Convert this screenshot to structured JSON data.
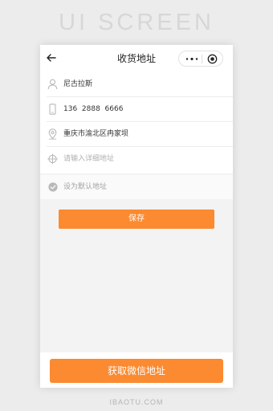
{
  "banner": {
    "text": "UI SCREEN"
  },
  "navbar": {
    "title": "收货地址",
    "back_icon": "arrow-left-icon",
    "menu_icon": "more-dots-icon",
    "close_icon": "target-circle-icon"
  },
  "form": {
    "rows": [
      {
        "icon": "person-icon",
        "text": "尼古拉斯",
        "placeholder": false
      },
      {
        "icon": "phone-icon",
        "text": "136  2888  6666",
        "placeholder": false
      },
      {
        "icon": "location-pin-icon",
        "text": "重庆市渝北区冉家坝",
        "placeholder": false
      },
      {
        "icon": "crosshair-icon",
        "text": "请输入详细地址",
        "placeholder": true
      }
    ],
    "default_label": "设为默认地址",
    "default_checked": true
  },
  "actions": {
    "save_label": "保存",
    "wechat_address_label": "获取微信地址"
  },
  "colors": {
    "accent": "#fb8a30",
    "background": "#f3f3f3"
  },
  "footer": {
    "text": "IBAOTU.COM"
  }
}
